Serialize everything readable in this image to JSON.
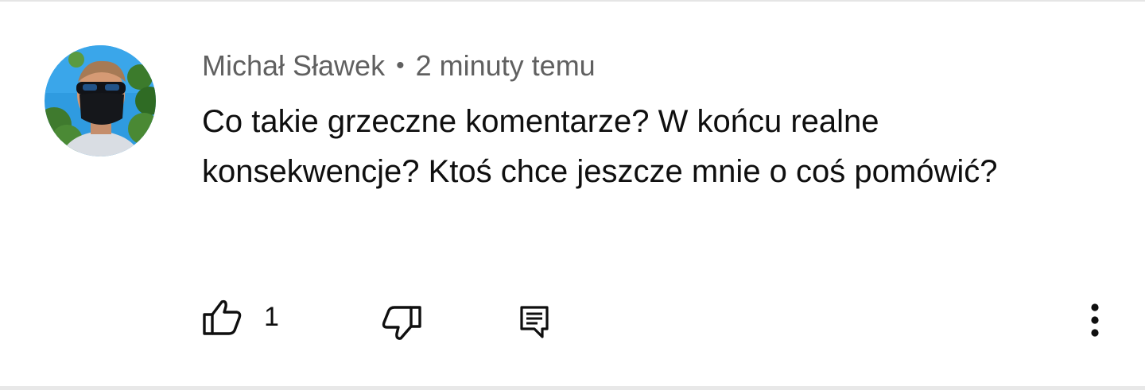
{
  "comment": {
    "author": "Michał Sławek",
    "separator": "•",
    "time": "2 minuty temu",
    "text": "Co takie grzeczne komentarze? W końcu realne konsekwencje? Ktoś chce jeszcze mnie o coś pomówić?",
    "avatar_icon": "user-avatar-photo",
    "actions": {
      "like_icon": "thumbs-up-icon",
      "like_count": "1",
      "dislike_icon": "thumbs-down-icon",
      "reply_icon": "reply-comment-icon",
      "more_icon": "more-vertical-icon"
    }
  },
  "colors": {
    "text_primary": "#0f0f0f",
    "text_secondary": "#606060",
    "background": "#ffffff"
  }
}
